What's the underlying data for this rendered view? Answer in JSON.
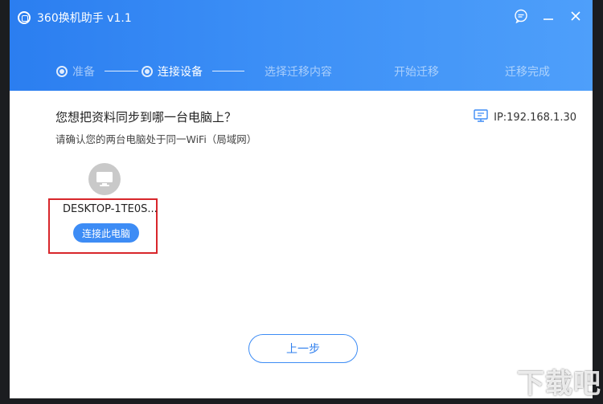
{
  "window": {
    "title": "360换机助手 v1.1",
    "colors": {
      "header_start": "#2b7ef0",
      "header_end": "#4e9ffa",
      "accent": "#3d8cf5",
      "highlight_border": "#d8262b"
    }
  },
  "controls": {
    "feedback_icon": "chat-icon",
    "minimize_icon": "minimize-icon",
    "close_icon": "close-icon"
  },
  "steps": [
    {
      "label": "准备",
      "state": "done"
    },
    {
      "label": "连接设备",
      "state": "active"
    },
    {
      "label": "选择迁移内容",
      "state": "pending"
    },
    {
      "label": "开始迁移",
      "state": "pending"
    },
    {
      "label": "迁移完成",
      "state": "pending"
    }
  ],
  "main": {
    "heading": "您想把资料同步到哪一台电脑上？",
    "subheading": "请确认您的两台电脑处于同一WiFi（局域网）",
    "ip_label": "IP:192.168.1.30",
    "ip_icon": "network-icon"
  },
  "device": {
    "name": "DESKTOP-1TE0S...",
    "icon": "monitor-icon",
    "connect_label": "连接此电脑"
  },
  "footer": {
    "prev_label": "上一步"
  },
  "watermark": {
    "text": "下载吧"
  }
}
